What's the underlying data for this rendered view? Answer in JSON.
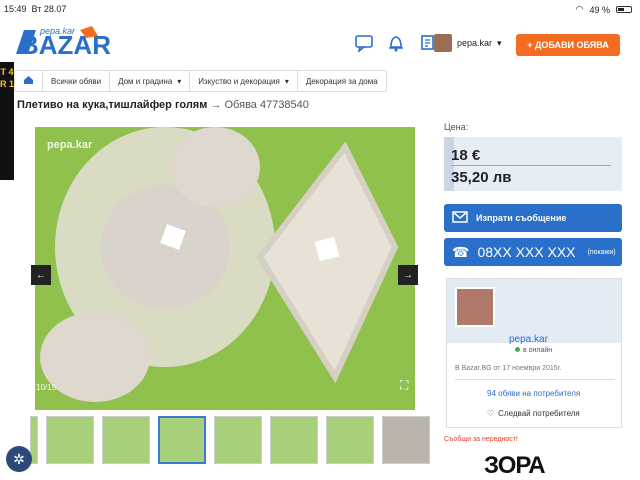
{
  "status_bar": {
    "time": "15:49",
    "date": "Вт 28.07",
    "battery": "49 %"
  },
  "header": {
    "logo": "BAZAR",
    "logo_top": "pepa.kar",
    "user_name": "pepa.kar",
    "add_button": "+ ДОБАВИ ОБЯВА"
  },
  "side_banner": {
    "text": "T 4 R 1"
  },
  "breadcrumbs": [
    {
      "label": "Всички обяви"
    },
    {
      "label": "Дом и градина"
    },
    {
      "label": "Изкуство и декорация"
    },
    {
      "label": "Декорация за дома"
    }
  ],
  "listing": {
    "title": "Плетиво на кука,тишлайфер голям",
    "arrow": "→",
    "id_text": "Обява 47738540"
  },
  "gallery": {
    "watermark": "pepa.kar",
    "counter": "10/15",
    "prev": "←",
    "next": "→",
    "thumbnail_count": 7,
    "selected_thumbnail": 3
  },
  "price": {
    "label": "Цена:",
    "bgn": "18 €",
    "eur": "35,20 лв"
  },
  "actions": {
    "message": "Изпрати съобщение",
    "phone": "08XX XXX XXX",
    "phone_reveal": "(покажи)"
  },
  "seller": {
    "name": "pepa.kar",
    "online": "в онлайн",
    "since": "В Bazar.BG от 17 ноември 2015г.",
    "listings": "94 обяви на потребителя",
    "follow": "Следвай потребителя"
  },
  "report": "Съобщи за нередност!",
  "ad": {
    "text": "ЗОРА",
    "logo": "BAZAR"
  },
  "colors": {
    "brand_orange": "#f36c21",
    "brand_blue": "#2a6fc9",
    "photo_bg": "#8fc14c"
  }
}
